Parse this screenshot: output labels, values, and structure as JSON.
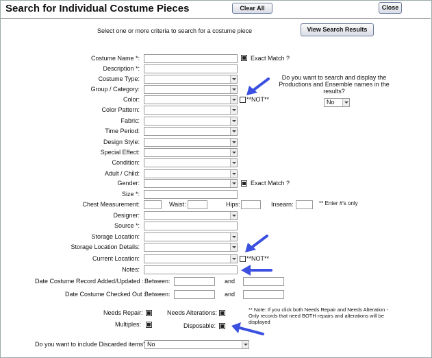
{
  "header": {
    "title": "Search for Individual Costume Pieces",
    "clear_all": "Clear All",
    "close": "Close"
  },
  "instructions": "Select one or more criteria to search for a costume piece",
  "view_results": "View Search Results",
  "labels": {
    "costume_name": "Costume Name *:",
    "description": "Description *:",
    "costume_type": "Costume Type:",
    "group_category": "Group / Category:",
    "color": "Color:",
    "color_pattern": "Color Pattern:",
    "fabric": "Fabric:",
    "time_period": "Time Period:",
    "design_style": "Design Style:",
    "special_effect": "Special Effect:",
    "condition": "Condition:",
    "adult_child": "Adult / Child:",
    "gender": "Gender:",
    "size": "Size *:",
    "chest": "Chest Measurement:",
    "waist": "Waist:",
    "hips": "Hips:",
    "inseam": "Insearn:",
    "enter_numbers": "** Enter #'s only",
    "designer": "Designer:",
    "source": "Source *:",
    "storage_location": "Storage Location:",
    "storage_details": "Storage Location Details:",
    "current_location": "Current Location:",
    "notes": "Notes:",
    "date_added": "Date Costume Record Added/Updated :",
    "date_checked": "Date Costume Checked Out :",
    "between": "Between:",
    "and": "and",
    "needs_repair": "Needs Repair:",
    "needs_alterations": "Needs Alterations:",
    "multiples": "Multiples:",
    "disposable": "Disposable:",
    "discarded_question": "Do you want to include Discarded items?"
  },
  "exact_match": "Exact Match ?",
  "not_label": "**NOT**",
  "productions_question": "Do you want to search and display the Productions and Ensemble names in the results?",
  "productions_answer": "No",
  "discarded_answer": "No",
  "repair_note": "** Note:  If you click both Needs Repair and Needs Alteration - Only records that need BOTH repairs and alterations will be displayed",
  "colors": {
    "annotation_arrow": "#3b4fe0"
  }
}
